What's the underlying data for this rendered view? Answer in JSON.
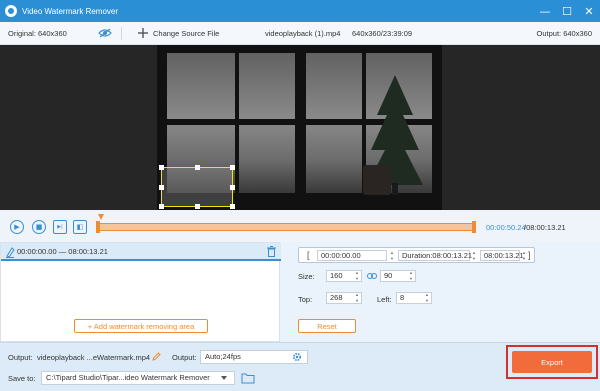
{
  "app": {
    "title": "Video Watermark Remover",
    "logo_icon": "app-logo-icon"
  },
  "window_controls": {
    "minimize": "—",
    "maximize": "☐",
    "close": "✕"
  },
  "info": {
    "original": "Original: 640x360",
    "change_source": "Change Source File",
    "filename": "videoplayback (1).mp4",
    "file_meta": "640x360/23:39:09",
    "output_res": "Output: 640x360"
  },
  "player": {
    "current_time": "00:00:50.24",
    "total_time": "/08:00:13.21",
    "buttons": [
      "play-icon",
      "stop-icon",
      "next-frame-icon",
      "screenshot-icon"
    ],
    "play_glyph": "▶",
    "stop_glyph": "■",
    "next_glyph": "▶|",
    "snap_glyph": "◧",
    "progress_fraction": 0.0017
  },
  "segment": {
    "time_range": "00:00:00.00 — 08:00:13.21"
  },
  "add_area_label": "+ Add watermark removing area",
  "range": {
    "open_bracket": "[",
    "close_bracket": "]",
    "start": "00:00:00.00",
    "duration_label": "Duration:08:00:13.21",
    "end": "08:00:13.21"
  },
  "size": {
    "label": "Size:",
    "width": "160",
    "height": "90"
  },
  "position": {
    "top_label": "Top:",
    "top": "268",
    "left_label": "Left:",
    "left": "8"
  },
  "reset_label": "Reset",
  "bottom": {
    "output_label": "Output:",
    "output_file": "videoplayback ...eWatermark.mp4",
    "output_format_label": "Output:",
    "output_format": "Auto;24fps",
    "save_label": "Save to:",
    "save_path": "C:\\Tipard Studio\\Tipar...ideo Watermark Remover",
    "export_label": "Export"
  },
  "colors": {
    "accent": "#2b8fd6",
    "orange": "#f08b35",
    "export": "#f26b3a",
    "highlight": "#d32f2f"
  }
}
